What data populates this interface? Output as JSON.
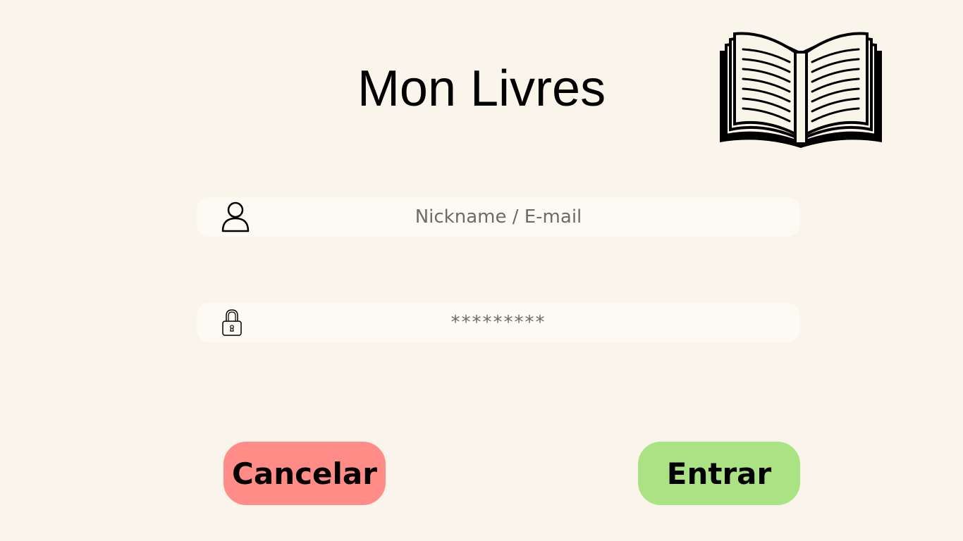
{
  "app": {
    "title": "Mon Livres",
    "logo_icon": "open-book-icon"
  },
  "login": {
    "username": {
      "icon": "user-icon",
      "placeholder": "Nickname / E-mail",
      "value": ""
    },
    "password": {
      "icon": "lock-icon",
      "placeholder": "*********",
      "value": ""
    }
  },
  "actions": {
    "cancel_label": "Cancelar",
    "cancel_color": "#ff8c86",
    "enter_label": "Entrar",
    "enter_color": "#abe384"
  },
  "colors": {
    "background": "#f9f5eb",
    "field_background": "#fdfaf3"
  }
}
